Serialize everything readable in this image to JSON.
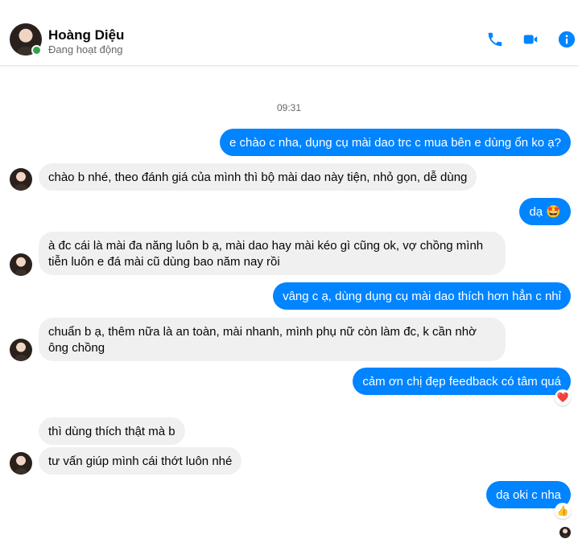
{
  "contact": {
    "name": "Hoàng Diệu",
    "status": "Đang hoạt động"
  },
  "header_icons": [
    "phone-icon",
    "video-camera-icon",
    "info-icon"
  ],
  "accent_color": "#0084ff",
  "timestamp": "09:31",
  "messages": [
    {
      "from": "me",
      "text": "e chào c nha, dụng cụ mài dao trc c mua bên e dùng ổn ko ạ?"
    },
    {
      "from": "them",
      "text": "chào b nhé, theo đánh giá của mình thì bộ mài dao này tiện, nhỏ gọn, dễ dùng"
    },
    {
      "from": "me",
      "text": "dạ 🤩"
    },
    {
      "from": "them",
      "text": "à đc cái là mài đa năng luôn b ạ, mài dao hay mài kéo gì cũng ok, vợ chồng mình tiễn luôn e đá mài cũ dùng bao năm nay rồi"
    },
    {
      "from": "me",
      "text": "vâng c ạ, dùng dụng cụ mài dao thích hơn hẳn c nhỉ"
    },
    {
      "from": "them",
      "text": "chuẩn b ạ, thêm nữa là an toàn, mài nhanh, mình phụ nữ còn làm đc, k cần nhờ ông chồng"
    },
    {
      "from": "me",
      "text": "cảm ơn chị đẹp feedback có tâm quá",
      "reaction": "❤️"
    },
    {
      "from": "them",
      "text": "thì dùng thích thật mà b"
    },
    {
      "from": "them",
      "text": "tư vấn giúp mình cái thớt luôn nhé"
    },
    {
      "from": "me",
      "text": "dạ oki c nha",
      "reaction": "👍"
    }
  ]
}
